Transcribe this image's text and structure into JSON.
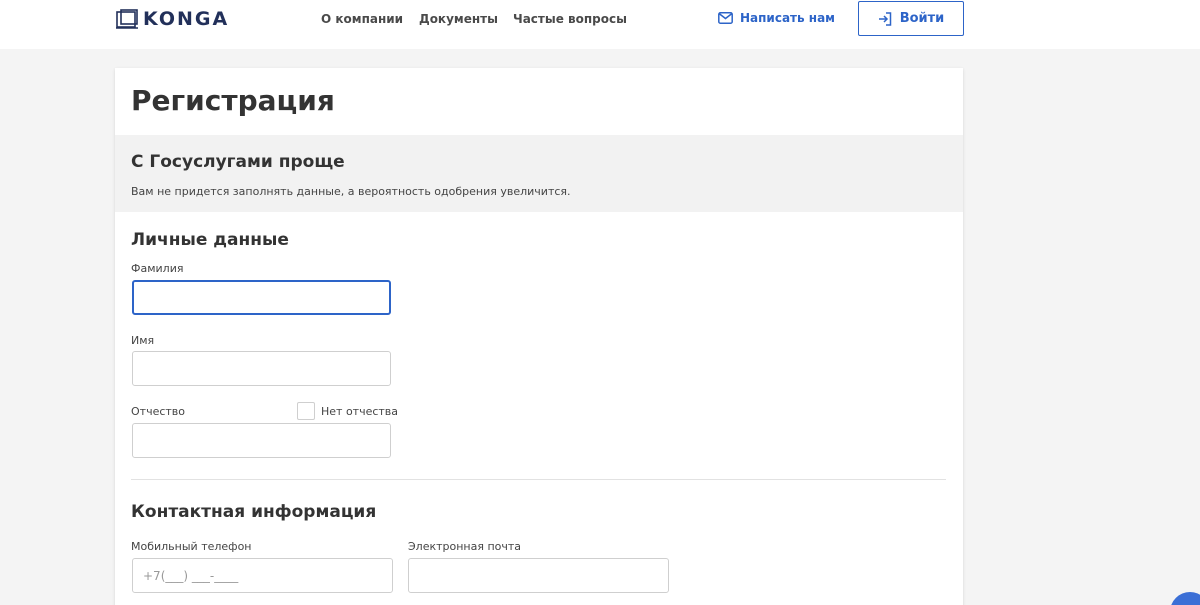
{
  "header": {
    "logo_text": "KONGA",
    "nav": [
      {
        "label": "О компании"
      },
      {
        "label": "Документы"
      },
      {
        "label": "Частые вопросы"
      }
    ],
    "write_us_label": "Написать нам",
    "login_label": "Войти"
  },
  "page": {
    "title": "Регистрация"
  },
  "gosuslugi": {
    "title": "С Госуслугами проще",
    "text": "Вам не придется заполнять данные, а вероятность одобрения увеличится."
  },
  "personal": {
    "title": "Личные данные",
    "surname_label": "Фамилия",
    "surname_value": "",
    "name_label": "Имя",
    "name_value": "",
    "patronymic_label": "Отчество",
    "patronymic_value": "",
    "no_patronymic_label": "Нет отчества",
    "no_patronymic_checked": false
  },
  "contact": {
    "title": "Контактная информация",
    "phone_label": "Мобильный телефон",
    "phone_placeholder": "+7(___) ___-____",
    "email_label": "Электронная почта",
    "email_value": ""
  },
  "colors": {
    "accent": "#2d64c8",
    "logo": "#22305a",
    "background": "#f4f4f4"
  }
}
